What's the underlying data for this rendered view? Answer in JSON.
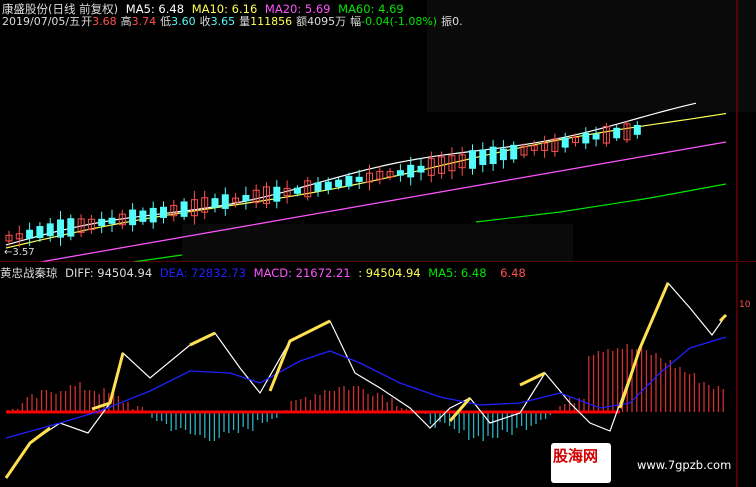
{
  "header": {
    "stock_title": "康盛股份(日线 前复权)",
    "ma5": "MA5: 6.48",
    "ma10": "MA10: 6.16",
    "ma20": "MA20: 5.69",
    "ma60": "MA60: 4.69",
    "date": "2019/07/05/五",
    "open_label": "开",
    "open": "3.68",
    "high_label": "高",
    "high": "3.74",
    "low_label": "低",
    "low": "3.60",
    "close_label": "收",
    "close": "3.65",
    "vol_label": "量",
    "vol": "111856",
    "amount_label": "额",
    "amount": "4095万",
    "change_label": "幅",
    "change": "-0.04(-1.08%)",
    "amp_label": "振0."
  },
  "price_low_label": "3.57",
  "indicator": {
    "name": "黄忠战秦琼",
    "diff": "DIFF: 94504.94",
    "dea": "DEA: 72832.73",
    "macd": "MACD: 21672.21",
    "val": ": 94504.94",
    "ma5": "MA5: 6.48",
    "extra": "6.48"
  },
  "axis_tick_right": "10",
  "watermark": {
    "logo": "股海网",
    "url": "www.7gpzb.com"
  },
  "colors": {
    "up": "#ff5050",
    "down": "#54fcfc",
    "ma5": "#ffffff",
    "ma10": "#ffff54",
    "ma20": "#ff54ff",
    "ma60": "#00e600",
    "dea": "#2020ff",
    "zero_line": "#ff0000"
  }
}
